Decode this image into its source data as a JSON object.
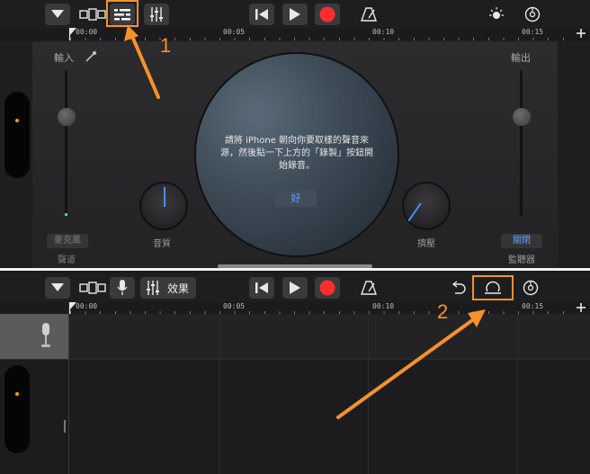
{
  "top_toolbar": {
    "ruler_labels": [
      "00:00",
      "00:05",
      "00:10",
      "00:15"
    ]
  },
  "top_panel": {
    "input_label": "輸入",
    "output_label": "輸出",
    "quality_label": "音質",
    "compressor_label": "擠壓",
    "mic_button_label": "麥克風",
    "mic_sub_label": "聲道",
    "monitor_state": "關閉",
    "monitor_label": "監聽器",
    "dialog_message": "請將 iPhone 朝向你要取樣的聲音來源，然後點一下上方的「錄製」按鈕開始錄音。",
    "ok_label": "好"
  },
  "bottom_toolbar": {
    "effects_label": "效果",
    "ruler_labels": [
      "00:00",
      "00:05",
      "00:10",
      "00:15"
    ]
  },
  "annotations": {
    "label_1": "1",
    "label_2": "2",
    "color": "#f5922a"
  },
  "colors": {
    "record": "#ff2d2d",
    "accent": "#ff9a00",
    "link": "#5aa7ff"
  }
}
